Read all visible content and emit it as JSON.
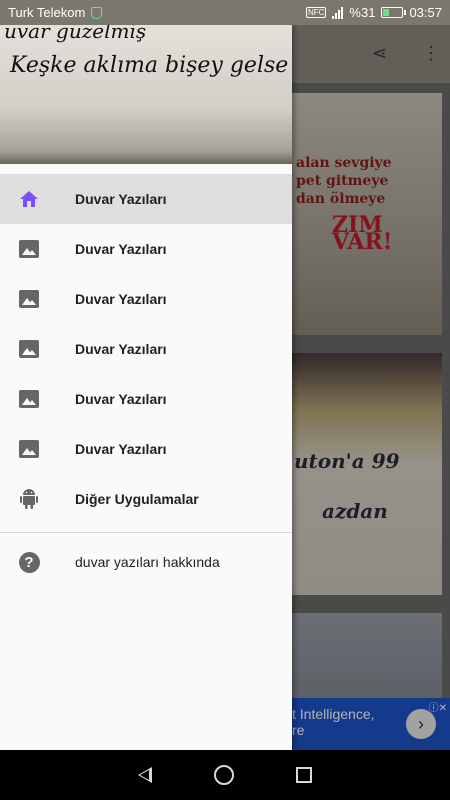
{
  "status_bar": {
    "carrier": "Turk Telekom",
    "nfc": "NFC",
    "battery_percent": "%31",
    "time": "03:57",
    "battery_level": 0.31
  },
  "background": {
    "card1_text": [
      "alan sevgiye",
      "pet gitmeye",
      "dan ölmeye",
      "ZIM VAR!"
    ],
    "card2_text": [
      "uton'a 99",
      "azdan"
    ],
    "ad_line1": "t Intelligence,",
    "ad_line2": "re"
  },
  "drawer": {
    "header_handwriting": [
      "uvar güzelmiş",
      "Keşke aklıma bişey gelse"
    ],
    "items": [
      {
        "label": "Duvar Yazıları",
        "icon": "home-icon",
        "active": true
      },
      {
        "label": "Duvar Yazıları",
        "icon": "image-icon"
      },
      {
        "label": "Duvar Yazıları",
        "icon": "image-icon"
      },
      {
        "label": "Duvar Yazıları",
        "icon": "image-icon"
      },
      {
        "label": "Duvar Yazıları",
        "icon": "image-icon"
      },
      {
        "label": "Duvar Yazıları",
        "icon": "image-icon"
      },
      {
        "label": "Diğer Uygulamalar",
        "icon": "android-icon"
      }
    ],
    "about_label": "duvar yazıları hakkında",
    "about_icon": "help-icon"
  },
  "colors": {
    "accent": "#7c4dff",
    "drawer_bg": "#fafafa",
    "active_row": "#dedede",
    "ad_bg": "#1d54c9"
  }
}
